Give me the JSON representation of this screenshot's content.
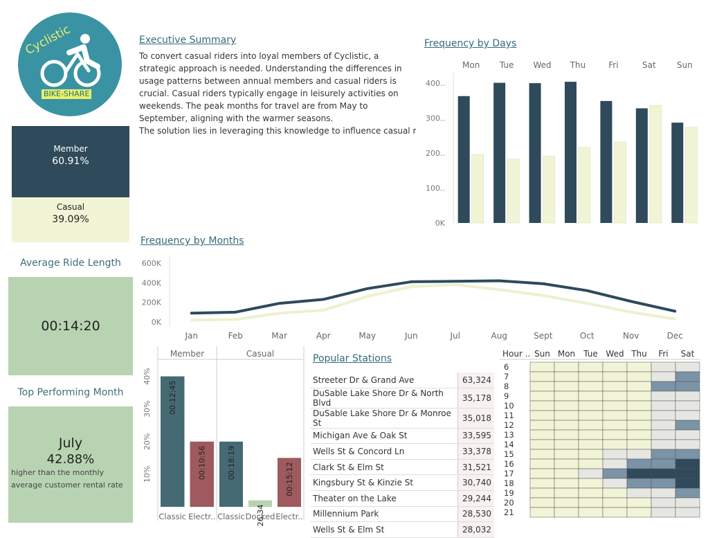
{
  "logo": {
    "name": "Cyclistic",
    "badge": "BIKE-SHARE"
  },
  "share": {
    "member_label": "Member",
    "member_value": "60.91%",
    "casual_label": "Casual",
    "casual_value": "39.09%"
  },
  "avg_ride": {
    "title": "Average Ride Length",
    "value": "00:14:20"
  },
  "top_month": {
    "title": "Top Performing Month",
    "month": "July",
    "pct": "42.88%",
    "note": "higher than the monthly average customer rental rate"
  },
  "summary": {
    "title": "Executive Summary",
    "para1": "To convert casual riders into loyal members of Cyclistic, a strategic approach is needed. Understanding the differences in usage patterns between annual members and casual riders is crucial. Casual riders typically engage in leisurely activities on weekends. The peak months for travel are from May to September, aligning with the warmer seasons.",
    "para2": "The solution lies in leveraging this knowledge to influence casual riders effectively. By tailoring marketing campaigns to coincide with weekends and peak travel months, Cyclistic can capture the attention of potential members. Recognizing the shift in preferences towards classic or electric bikes indicates that convenience remains a key consideration. Utilizing digital media platforms strategically can further enhance the outreach efforts, enticing casual riders to embrace annual memberships and become dedicated users of Cyclisti.."
  },
  "colors": {
    "member": "#2e4a5b",
    "casual": "#f2f4d6",
    "teal_bar": "#456a73",
    "red_bar": "#9e5a5e",
    "green_bar": "#b8d3b1",
    "title": "#336b7a"
  },
  "stations_title": "Popular Stations",
  "stations": [
    {
      "name": "Streeter Dr & Grand Ave",
      "count": "63,324"
    },
    {
      "name": "DuSable Lake Shore Dr & North Blvd",
      "count": "35,178"
    },
    {
      "name": "DuSable Lake Shore Dr & Monroe St",
      "count": "35,018"
    },
    {
      "name": "Michigan Ave & Oak St",
      "count": "33,595"
    },
    {
      "name": "Wells St & Concord Ln",
      "count": "33,378"
    },
    {
      "name": "Clark St & Elm St",
      "count": "31,521"
    },
    {
      "name": "Kingsbury St & Kinzie St",
      "count": "30,740"
    },
    {
      "name": "Theater on the Lake",
      "count": "29,244"
    },
    {
      "name": "Millennium Park",
      "count": "28,530"
    },
    {
      "name": "Wells St & Elm St",
      "count": "28,032"
    }
  ],
  "chart_data": [
    {
      "id": "days",
      "type": "bar",
      "title": "Frequency by Days",
      "categories": [
        "Mon",
        "Tue",
        "Wed",
        "Thu",
        "Fri",
        "Sat",
        "Sun"
      ],
      "series": [
        {
          "values": [
            363000,
            401000,
            400000,
            404000,
            349000,
            328000,
            287000
          ]
        },
        {
          "values": [
            196000,
            183000,
            191000,
            216000,
            232000,
            336000,
            274000
          ]
        }
      ],
      "yticks": [
        "0K",
        "100..",
        "200..",
        "300..",
        "400.."
      ],
      "ylim": [
        0,
        420000
      ]
    },
    {
      "id": "months",
      "type": "line",
      "title": "Frequency by Months",
      "categories": [
        "Jan",
        "Feb",
        "Mar",
        "Apr",
        "May",
        "Jun",
        "Jul",
        "Aug",
        "Sept",
        "Oct",
        "Nov",
        "Dec"
      ],
      "series": [
        {
          "values": [
            90000,
            100000,
            190000,
            230000,
            340000,
            410000,
            415000,
            420000,
            390000,
            320000,
            210000,
            110000
          ]
        },
        {
          "values": [
            20000,
            25000,
            90000,
            120000,
            260000,
            360000,
            380000,
            330000,
            270000,
            190000,
            100000,
            30000
          ]
        }
      ],
      "yticks": [
        "0K",
        "200K",
        "400K",
        "600K"
      ],
      "ylim": [
        0,
        600000
      ]
    },
    {
      "id": "ride_length",
      "type": "bar",
      "groups": [
        {
          "name": "Member",
          "bars": [
            {
              "label": "Classic",
              "value": 0.4,
              "text": "00:12:45",
              "color": "teal"
            },
            {
              "label": "Electr..",
              "value": 0.2,
              "text": "00:10:56",
              "color": "red"
            }
          ]
        },
        {
          "name": "Casual",
          "bars": [
            {
              "label": "Classic",
              "value": 0.2,
              "text": "00:18:19",
              "color": "teal"
            },
            {
              "label": "Docked",
              "value": 0.02,
              "text": "00:26:34",
              "color": "green"
            },
            {
              "label": "Electr..",
              "value": 0.15,
              "text": "00:15:12",
              "color": "red"
            }
          ]
        }
      ],
      "yticks": [
        "10%",
        "20%",
        "30%",
        "40%"
      ],
      "ylim": [
        0,
        0.45
      ]
    },
    {
      "id": "heatmap",
      "type": "heatmap",
      "row_header": "Hour ..",
      "columns": [
        "Sun",
        "Mon",
        "Tue",
        "Wed",
        "Thu",
        "Fri",
        "Sat"
      ],
      "rows": [
        "6",
        "7",
        "8",
        "9",
        "10",
        "11",
        "12",
        "13",
        "14",
        "15",
        "16",
        "17",
        "18",
        "19",
        "20",
        "21"
      ],
      "values": [
        [
          0,
          0,
          0,
          0,
          0,
          1,
          1
        ],
        [
          0,
          0,
          0,
          0,
          0,
          1,
          4
        ],
        [
          0,
          0,
          0,
          0,
          0,
          4,
          4
        ],
        [
          0,
          0,
          0,
          0,
          0,
          1,
          1
        ],
        [
          0,
          0,
          0,
          0,
          0,
          1,
          1
        ],
        [
          0,
          0,
          0,
          0,
          0,
          1,
          1
        ],
        [
          0,
          0,
          0,
          0,
          0,
          1,
          4
        ],
        [
          0,
          0,
          0,
          0,
          0,
          1,
          1
        ],
        [
          0,
          0,
          0,
          0,
          0,
          1,
          1
        ],
        [
          0,
          0,
          0,
          1,
          1,
          4,
          4
        ],
        [
          0,
          0,
          0,
          1,
          4,
          4,
          5
        ],
        [
          0,
          0,
          1,
          4,
          5,
          5,
          5
        ],
        [
          0,
          0,
          0,
          1,
          4,
          4,
          5
        ],
        [
          0,
          0,
          0,
          0,
          1,
          1,
          4
        ],
        [
          0,
          0,
          0,
          0,
          0,
          1,
          1
        ],
        [
          0,
          0,
          0,
          0,
          0,
          1,
          1
        ]
      ]
    }
  ]
}
